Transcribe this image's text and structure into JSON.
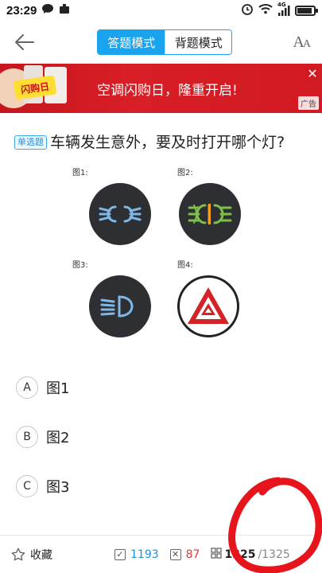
{
  "status": {
    "time": "23:29",
    "network": "4G",
    "battery_level": 0.9
  },
  "nav": {
    "back_icon": "arrow-left-icon",
    "mode_answer": "答题模式",
    "mode_recite": "背题模式",
    "font_icon": "font-size-icon"
  },
  "ad": {
    "headline": "空调闪购日，隆重开启!",
    "badge": "广告",
    "image_text": "闪购日"
  },
  "question": {
    "type": "单选题",
    "text": "车辆发生意外，要及时打开哪个灯?"
  },
  "figure": {
    "labels": [
      "图1:",
      "图2:",
      "图3:",
      "图4:"
    ]
  },
  "options": [
    {
      "letter": "A",
      "text": "图1"
    },
    {
      "letter": "B",
      "text": "图2"
    },
    {
      "letter": "C",
      "text": "图3"
    }
  ],
  "bottom": {
    "favorite": "收藏",
    "right_count": "1193",
    "wrong_count": "87",
    "current": "1325",
    "total": "/1325"
  },
  "colors": {
    "accent": "#1aa3ef",
    "ad_red": "#d21a22",
    "wrong": "#e03a3a",
    "annotation": "#e8141c"
  }
}
